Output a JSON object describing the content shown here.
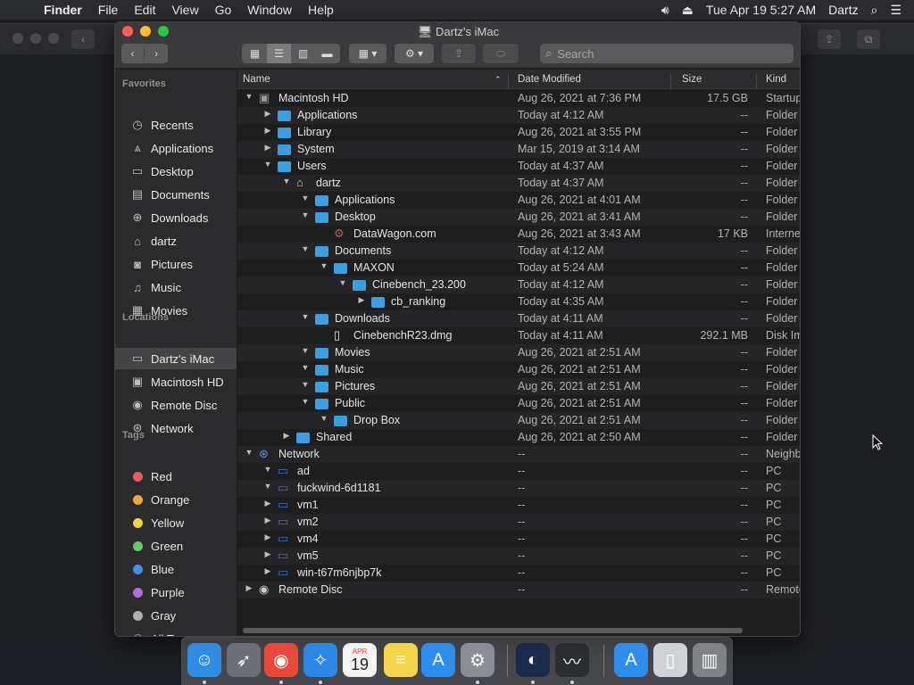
{
  "menubar": {
    "app": "Finder",
    "items": [
      "File",
      "Edit",
      "View",
      "Go",
      "Window",
      "Help"
    ],
    "clock": "Tue Apr 19  5:27 AM",
    "user": "Dartz"
  },
  "window": {
    "title": "Dartz's iMac",
    "search_placeholder": "Search"
  },
  "sidebar": {
    "favorites_header": "Favorites",
    "favorites": [
      {
        "label": "Recents",
        "icon": "clock-icon"
      },
      {
        "label": "Applications",
        "icon": "applications-icon"
      },
      {
        "label": "Desktop",
        "icon": "desktop-icon"
      },
      {
        "label": "Documents",
        "icon": "document-icon"
      },
      {
        "label": "Downloads",
        "icon": "download-icon"
      },
      {
        "label": "dartz",
        "icon": "home-icon"
      },
      {
        "label": "Pictures",
        "icon": "camera-icon"
      },
      {
        "label": "Music",
        "icon": "music-icon"
      },
      {
        "label": "Movies",
        "icon": "film-icon"
      }
    ],
    "locations_header": "Locations",
    "locations": [
      {
        "label": "Dartz's iMac",
        "icon": "computer-icon"
      },
      {
        "label": "Macintosh HD",
        "icon": "disk-icon"
      },
      {
        "label": "Remote Disc",
        "icon": "disc-icon"
      },
      {
        "label": "Network",
        "icon": "globe-icon"
      }
    ],
    "tags_header": "Tags",
    "tags": [
      {
        "label": "Red",
        "color": "#ee5a5a"
      },
      {
        "label": "Orange",
        "color": "#f2a33a"
      },
      {
        "label": "Yellow",
        "color": "#f5d33d"
      },
      {
        "label": "Green",
        "color": "#5fcf5c"
      },
      {
        "label": "Blue",
        "color": "#3f8ff2"
      },
      {
        "label": "Purple",
        "color": "#b66ae0"
      },
      {
        "label": "Gray",
        "color": "#b0b0b0"
      },
      {
        "label": "All Tags...",
        "color": ""
      }
    ]
  },
  "columns": {
    "name": "Name",
    "date": "Date Modified",
    "size": "Size",
    "kind": "Kind"
  },
  "rows": [
    {
      "indent": 0,
      "disc": "▼",
      "icon": "disk-icon",
      "name": "Macintosh HD",
      "date": "Aug 26, 2021 at 7:36 PM",
      "size": "17.5 GB",
      "kind": "Startup"
    },
    {
      "indent": 1,
      "disc": "▶",
      "icon": "folder-icon",
      "name": "Applications",
      "date": "Today at 4:12 AM",
      "size": "--",
      "kind": "Folder"
    },
    {
      "indent": 1,
      "disc": "▶",
      "icon": "folder-icon",
      "name": "Library",
      "date": "Aug 26, 2021 at 3:55 PM",
      "size": "--",
      "kind": "Folder"
    },
    {
      "indent": 1,
      "disc": "▶",
      "icon": "folder-icon",
      "name": "System",
      "date": "Mar 15, 2019 at 3:14 AM",
      "size": "--",
      "kind": "Folder"
    },
    {
      "indent": 1,
      "disc": "▼",
      "icon": "folder-icon",
      "name": "Users",
      "date": "Today at 4:37 AM",
      "size": "--",
      "kind": "Folder"
    },
    {
      "indent": 2,
      "disc": "▼",
      "icon": "home-icon",
      "name": "dartz",
      "date": "Today at 4:37 AM",
      "size": "--",
      "kind": "Folder"
    },
    {
      "indent": 3,
      "disc": "▼",
      "icon": "folder-icon",
      "name": "Applications",
      "date": "Aug 26, 2021 at 4:01 AM",
      "size": "--",
      "kind": "Folder"
    },
    {
      "indent": 3,
      "disc": "▼",
      "icon": "folder-icon",
      "name": "Desktop",
      "date": "Aug 26, 2021 at 3:41 AM",
      "size": "--",
      "kind": "Folder"
    },
    {
      "indent": 4,
      "disc": "",
      "icon": "gear-icon",
      "name": "DataWagon.com",
      "date": "Aug 26, 2021 at 3:43 AM",
      "size": "17 KB",
      "kind": "Interne"
    },
    {
      "indent": 3,
      "disc": "▼",
      "icon": "folder-icon",
      "name": "Documents",
      "date": "Today at 4:12 AM",
      "size": "--",
      "kind": "Folder"
    },
    {
      "indent": 4,
      "disc": "▼",
      "icon": "folder-icon",
      "name": "MAXON",
      "date": "Today at 5:24 AM",
      "size": "--",
      "kind": "Folder"
    },
    {
      "indent": 5,
      "disc": "▼",
      "icon": "folder-icon",
      "name": "Cinebench_23.200",
      "date": "Today at 4:12 AM",
      "size": "--",
      "kind": "Folder"
    },
    {
      "indent": 6,
      "disc": "▶",
      "icon": "folder-icon",
      "name": "cb_ranking",
      "date": "Today at 4:35 AM",
      "size": "--",
      "kind": "Folder"
    },
    {
      "indent": 3,
      "disc": "▼",
      "icon": "folder-icon",
      "name": "Downloads",
      "date": "Today at 4:11 AM",
      "size": "--",
      "kind": "Folder"
    },
    {
      "indent": 4,
      "disc": "",
      "icon": "file-icon",
      "name": "CinebenchR23.dmg",
      "date": "Today at 4:11 AM",
      "size": "292.1 MB",
      "kind": "Disk Im"
    },
    {
      "indent": 3,
      "disc": "▼",
      "icon": "folder-icon",
      "name": "Movies",
      "date": "Aug 26, 2021 at 2:51 AM",
      "size": "--",
      "kind": "Folder"
    },
    {
      "indent": 3,
      "disc": "▼",
      "icon": "folder-icon",
      "name": "Music",
      "date": "Aug 26, 2021 at 2:51 AM",
      "size": "--",
      "kind": "Folder"
    },
    {
      "indent": 3,
      "disc": "▼",
      "icon": "folder-icon",
      "name": "Pictures",
      "date": "Aug 26, 2021 at 2:51 AM",
      "size": "--",
      "kind": "Folder"
    },
    {
      "indent": 3,
      "disc": "▼",
      "icon": "folder-icon",
      "name": "Public",
      "date": "Aug 26, 2021 at 2:51 AM",
      "size": "--",
      "kind": "Folder"
    },
    {
      "indent": 4,
      "disc": "▼",
      "icon": "folder-icon",
      "name": "Drop Box",
      "date": "Aug 26, 2021 at 2:51 AM",
      "size": "--",
      "kind": "Folder"
    },
    {
      "indent": 2,
      "disc": "▶",
      "icon": "folder-icon",
      "name": "Shared",
      "date": "Aug 26, 2021 at 2:50 AM",
      "size": "--",
      "kind": "Folder"
    },
    {
      "indent": 0,
      "disc": "▼",
      "icon": "globe-icon",
      "name": "Network",
      "date": "--",
      "size": "--",
      "kind": "Neighb"
    },
    {
      "indent": 1,
      "disc": "▼",
      "icon": "computer-icon",
      "name": "ad",
      "date": "--",
      "size": "--",
      "kind": "PC"
    },
    {
      "indent": 1,
      "disc": "▼",
      "icon": "computer-icon",
      "name": "fuckwind-6d1181",
      "date": "--",
      "size": "--",
      "kind": "PC"
    },
    {
      "indent": 1,
      "disc": "▶",
      "icon": "computer-icon",
      "name": "vm1",
      "date": "--",
      "size": "--",
      "kind": "PC"
    },
    {
      "indent": 1,
      "disc": "▶",
      "icon": "computer-icon",
      "name": "vm2",
      "date": "--",
      "size": "--",
      "kind": "PC"
    },
    {
      "indent": 1,
      "disc": "▶",
      "icon": "computer-icon",
      "name": "vm4",
      "date": "--",
      "size": "--",
      "kind": "PC"
    },
    {
      "indent": 1,
      "disc": "▶",
      "icon": "computer-icon",
      "name": "vm5",
      "date": "--",
      "size": "--",
      "kind": "PC"
    },
    {
      "indent": 1,
      "disc": "▶",
      "icon": "computer-icon",
      "name": "win-t67m6njbp7k",
      "date": "--",
      "size": "--",
      "kind": "PC"
    },
    {
      "indent": 0,
      "disc": "▶",
      "icon": "disc-icon",
      "name": "Remote Disc",
      "date": "--",
      "size": "--",
      "kind": "Remote"
    }
  ],
  "dock": [
    {
      "name": "finder-app",
      "icon": "finder-icon",
      "color": "#2f8de4",
      "running": true
    },
    {
      "name": "launchpad-app",
      "icon": "rocket-icon",
      "color": "#6b6f78",
      "running": false
    },
    {
      "name": "chrome-app",
      "icon": "chrome-icon",
      "color": "#e9483b",
      "running": true
    },
    {
      "name": "safari-app",
      "icon": "compass-icon",
      "color": "#2a87e6",
      "running": true
    },
    {
      "name": "calendar-app",
      "icon": "calendar-icon",
      "color": "#f4f4f4",
      "running": false
    },
    {
      "name": "notes-app",
      "icon": "notes-icon",
      "color": "#f5d54a",
      "running": false
    },
    {
      "name": "appstore-app",
      "icon": "appstore-icon",
      "color": "#2d8ef0",
      "running": false
    },
    {
      "name": "preferences-app",
      "icon": "gear-icon",
      "color": "#8a8d93",
      "running": true
    },
    {
      "name": "cinema4d-app",
      "icon": "cinema4d-icon",
      "color": "#1a2a4a",
      "running": true
    },
    {
      "name": "activity-monitor-app",
      "icon": "activity-icon",
      "color": "#2a2e30",
      "running": true
    },
    {
      "name": "appstore-download",
      "icon": "appstore-icon",
      "color": "#2d8ef0",
      "running": false
    },
    {
      "name": "disk-image",
      "icon": "disk-image-icon",
      "color": "#cfd2d6",
      "running": false
    },
    {
      "name": "trash",
      "icon": "trash-icon",
      "color": "#7f8287",
      "running": false
    }
  ],
  "calendar_day": "19",
  "calendar_month": "APR"
}
